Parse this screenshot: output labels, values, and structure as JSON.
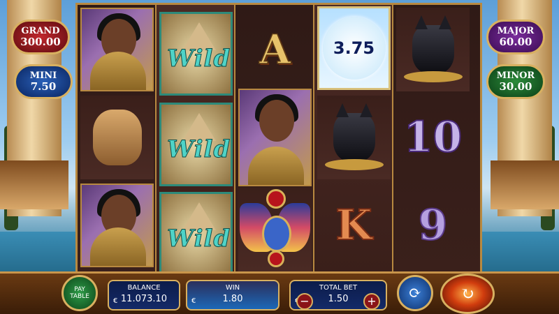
{
  "jackpots": {
    "grand": {
      "label": "GRAND",
      "value": "300.00",
      "color": "#c2272d"
    },
    "mini": {
      "label": "MINI",
      "value": "7.50",
      "color": "#2a60b8"
    },
    "major": {
      "label": "MAJOR",
      "value": "60.00",
      "color": "#7a2c9c"
    },
    "minor": {
      "label": "MINOR",
      "value": "30.00",
      "color": "#2c8b3a"
    }
  },
  "reels": {
    "reel1": [
      "queen",
      "lioness",
      "queen"
    ],
    "reel2": [
      "wild",
      "wild",
      "wild"
    ],
    "reel3": [
      "A",
      "queen-expanded",
      "scarab"
    ],
    "reel4": [
      "coin",
      "cat",
      "K"
    ],
    "reel5": [
      "cat",
      "10",
      "9"
    ]
  },
  "symbols": {
    "wild_text": "Wild",
    "letter_a": "A",
    "letter_k": "K",
    "num_10": "10",
    "num_9": "9",
    "coin_value": "3.75"
  },
  "bottom_bar": {
    "paytable_label": "PAY TABLE",
    "balance_label": "BALANCE",
    "balance_value": "11.073.10",
    "win_label": "WIN",
    "win_value": "1.80",
    "total_bet_label": "TOTAL BET",
    "total_bet_value": "1.50",
    "currency": "€",
    "bet_minus": "−",
    "bet_plus": "+",
    "autoplay_icon": "autoplay-icon",
    "spin_icon": "spin-icon"
  }
}
